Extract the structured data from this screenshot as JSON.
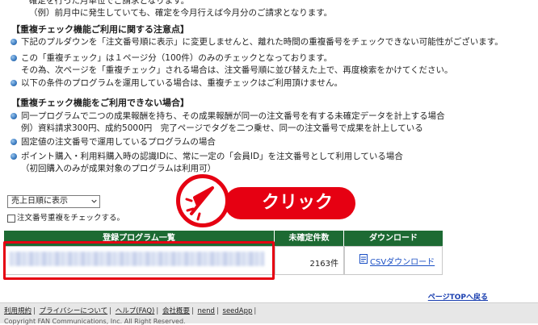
{
  "notes": {
    "top_line1": "確定を行った月単位でご請求となります。",
    "top_line2": "（例）前月中に発生していても、確定を今月行えば今月分のご請求となります。",
    "section1_title": "【重複チェック機能ご利用に関する注意点】",
    "section1_items": [
      "下記のプルダウンを「注文番号順に表示」に変更しませんと、離れた時間の重複番号をチェックできない可能性がございます。",
      "この「重複チェック」は１ページ分（100件）のみのチェックとなっております。",
      "その為、次ページを「重複チェック」される場合は、注文番号順に並び替えた上で、再度検索をかけてください。",
      "以下の条件のプログラムを運用している場合は、重複チェックはご利用頂けません。"
    ],
    "section2_title": "【重複チェック機能をご利用できない場合】",
    "section2_items": [
      "同一プログラムで二つの成果報酬を持ち、その成果報酬が同一の注文番号を有する未確定データを計上する場合",
      "例）資料請求300円、成約5000円　完了ページでタグを二つ乗せ、同一の注文番号で成果を計上している",
      "固定値の注文番号で運用しているプログラムの場合",
      "ポイント購入・利用料購入時の認識IDに、常に一定の「会員ID」を注文番号として利用している場合",
      "（初回購入のみが成果対象のプログラムは利用可）"
    ]
  },
  "controls": {
    "sort_selected": "売上日順に表示",
    "duplicate_check_label": "注文番号重複をチェックする。"
  },
  "table": {
    "headers": [
      "登録プログラム一覧",
      "未確定件数",
      "ダウンロード"
    ],
    "row": {
      "count": "2163件",
      "download_label": "CSVダウンロード"
    }
  },
  "badge": {
    "text": "クリック"
  },
  "nav": {
    "page_top": "ページTOPへ戻る"
  },
  "footer": {
    "links": [
      "利用規約",
      "プライバシーについて",
      "ヘルプ(FAQ)",
      "会社概要",
      "nend",
      "seedApp"
    ],
    "copyright": "Copyright FAN Communications, Inc. All Right Reserved."
  },
  "colors": {
    "header_green": "#1d6a33",
    "accent_red": "#e60012",
    "link_blue": "#1a4fc4"
  }
}
